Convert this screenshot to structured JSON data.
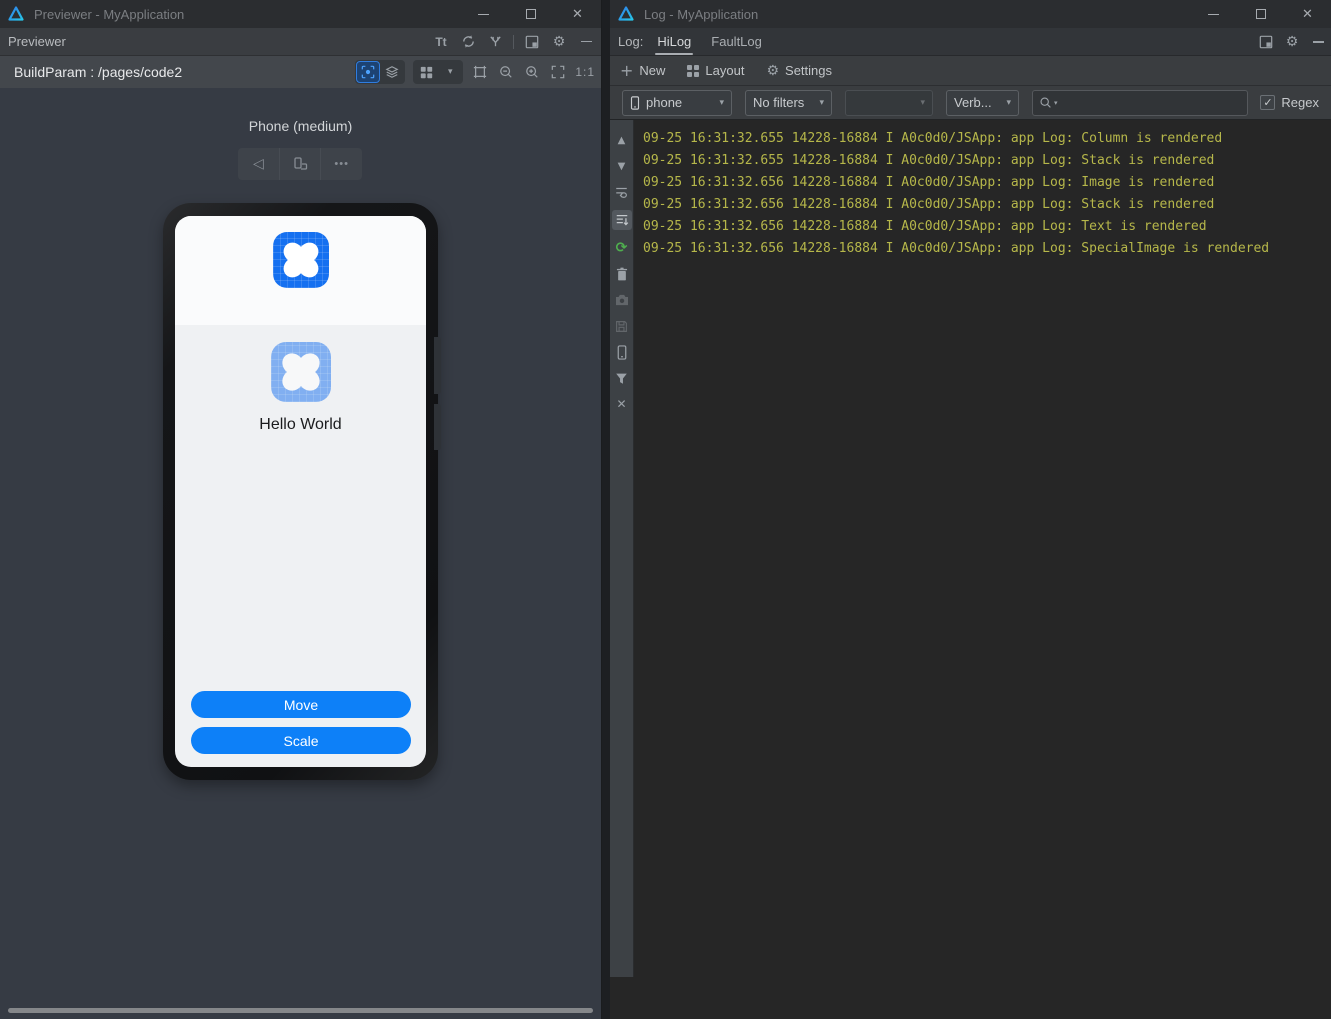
{
  "icons": {
    "check": "✓",
    "dropdown": "▾",
    "up": "▲",
    "down": "▼",
    "gear": "⚙",
    "close": "✕",
    "restart": "⟳",
    "back": "◁",
    "more": "•••",
    "plus": "+",
    "font_tool": "Tt"
  },
  "previewer": {
    "title": "Previewer - MyApplication",
    "tab": "Previewer",
    "build_param_label": "BuildParam : /pages/code2",
    "zoom_ratio": "1:1",
    "device_label": "Phone (medium)",
    "phone": {
      "hello": "Hello World",
      "move": "Move",
      "scale": "Scale"
    }
  },
  "log": {
    "title": "Log - MyApplication",
    "label": "Log:",
    "tabs": [
      {
        "label": "HiLog"
      },
      {
        "label": "FaultLog"
      }
    ],
    "actions": {
      "new": "New",
      "layout": "Layout",
      "settings": "Settings"
    },
    "filters": {
      "device": "phone",
      "filter": "No filters",
      "level": "Verb...",
      "regex": "Regex",
      "regex_checked": true,
      "search_value": ""
    },
    "lines": [
      "09-25 16:31:32.655 14228-16884 I A0c0d0/JSApp: app Log: Column is rendered",
      "09-25 16:31:32.655 14228-16884 I A0c0d0/JSApp: app Log: Stack is rendered",
      "09-25 16:31:32.656 14228-16884 I A0c0d0/JSApp: app Log: Image is rendered",
      "09-25 16:31:32.656 14228-16884 I A0c0d0/JSApp: app Log: Stack is rendered",
      "09-25 16:31:32.656 14228-16884 I A0c0d0/JSApp: app Log: Text is rendered",
      "09-25 16:31:32.656 14228-16884 I A0c0d0/JSApp: app Log: SpecialImage is rendered"
    ]
  },
  "colors": {
    "accent_blue": "#0d80f8",
    "app_icon_blue": "#1570f0",
    "log_text": "#b6b74a",
    "restart_green": "#4fae4e"
  }
}
